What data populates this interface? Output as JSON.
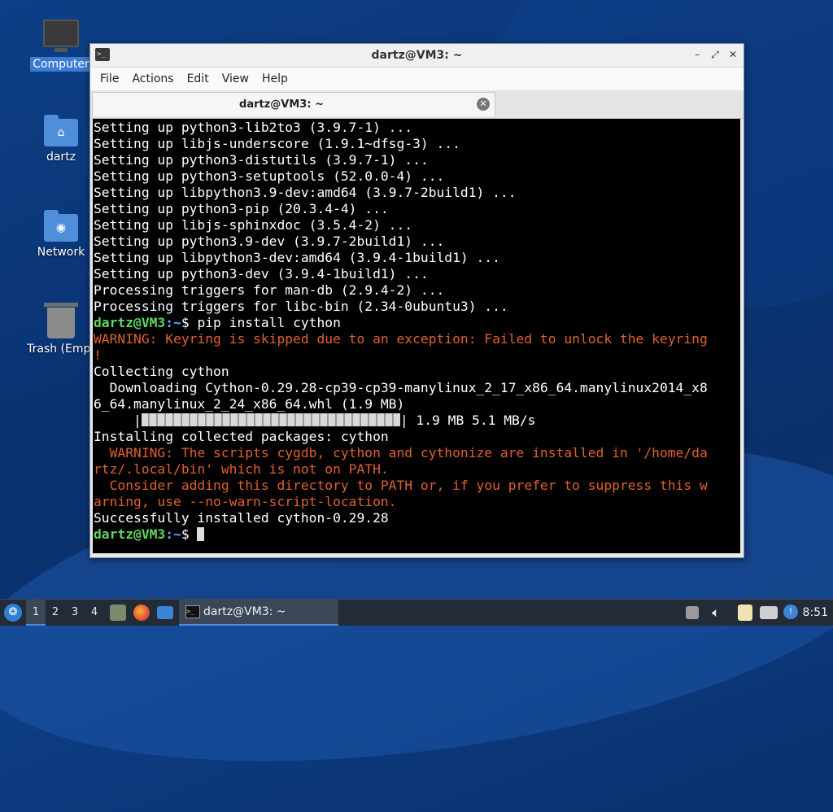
{
  "desktop": {
    "icons": [
      {
        "label": "Computer"
      },
      {
        "label": "dartz"
      },
      {
        "label": "Network"
      },
      {
        "label": "Trash (Empt"
      }
    ]
  },
  "window": {
    "title": "dartz@VM3: ~",
    "menu": [
      "File",
      "Actions",
      "Edit",
      "View",
      "Help"
    ],
    "tab": {
      "label": "dartz@VM3: ~"
    }
  },
  "terminal": {
    "prompt_user": "dartz@VM3",
    "prompt_path": ":~",
    "prompt_symbol": "$ ",
    "lines": [
      "Setting up python3-lib2to3 (3.9.7-1) ...",
      "Setting up libjs-underscore (1.9.1~dfsg-3) ...",
      "Setting up python3-distutils (3.9.7-1) ...",
      "Setting up python3-setuptools (52.0.0-4) ...",
      "Setting up libpython3.9-dev:amd64 (3.9.7-2build1) ...",
      "Setting up python3-pip (20.3.4-4) ...",
      "Setting up libjs-sphinxdoc (3.5.4-2) ...",
      "Setting up python3.9-dev (3.9.7-2build1) ...",
      "Setting up libpython3-dev:amd64 (3.9.4-1build1) ...",
      "Setting up python3-dev (3.9.4-1build1) ...",
      "Processing triggers for man-db (2.9.4-2) ...",
      "Processing triggers for libc-bin (2.34-0ubuntu3) ..."
    ],
    "command": "pip install cython",
    "warning1a": "WARNING: Keyring is skipped due to an exception: Failed to unlock the keyring",
    "warning1b": "!",
    "collecting": "Collecting cython",
    "download_a": "  Downloading Cython-0.29.28-cp39-cp39-manylinux_2_17_x86_64.manylinux2014_x8",
    "download_b": "6_64.manylinux_2_24_x86_64.whl (1.9 MB)",
    "progress_prefix": "     |",
    "progress_suffix": "| 1.9 MB 5.1 MB/s",
    "progress_fraction": 1.0,
    "installing": "Installing collected packages: cython",
    "warn2a": "  WARNING: The scripts cygdb, cython and cythonize are installed in '/home/da",
    "warn2b": "rtz/.local/bin' which is not on PATH.",
    "warn2c": "  Consider adding this directory to PATH or, if you prefer to suppress this w",
    "warn2d": "arning, use --no-warn-script-location.",
    "success": "Successfully installed cython-0.29.28"
  },
  "taskbar": {
    "workspaces": [
      "1",
      "2",
      "3",
      "4"
    ],
    "task_label": "dartz@VM3: ~",
    "clock": "8:51"
  },
  "colors": {
    "prompt_user": "#5fd75f",
    "prompt_path": "#5fafff",
    "warning": "#e0612c"
  }
}
